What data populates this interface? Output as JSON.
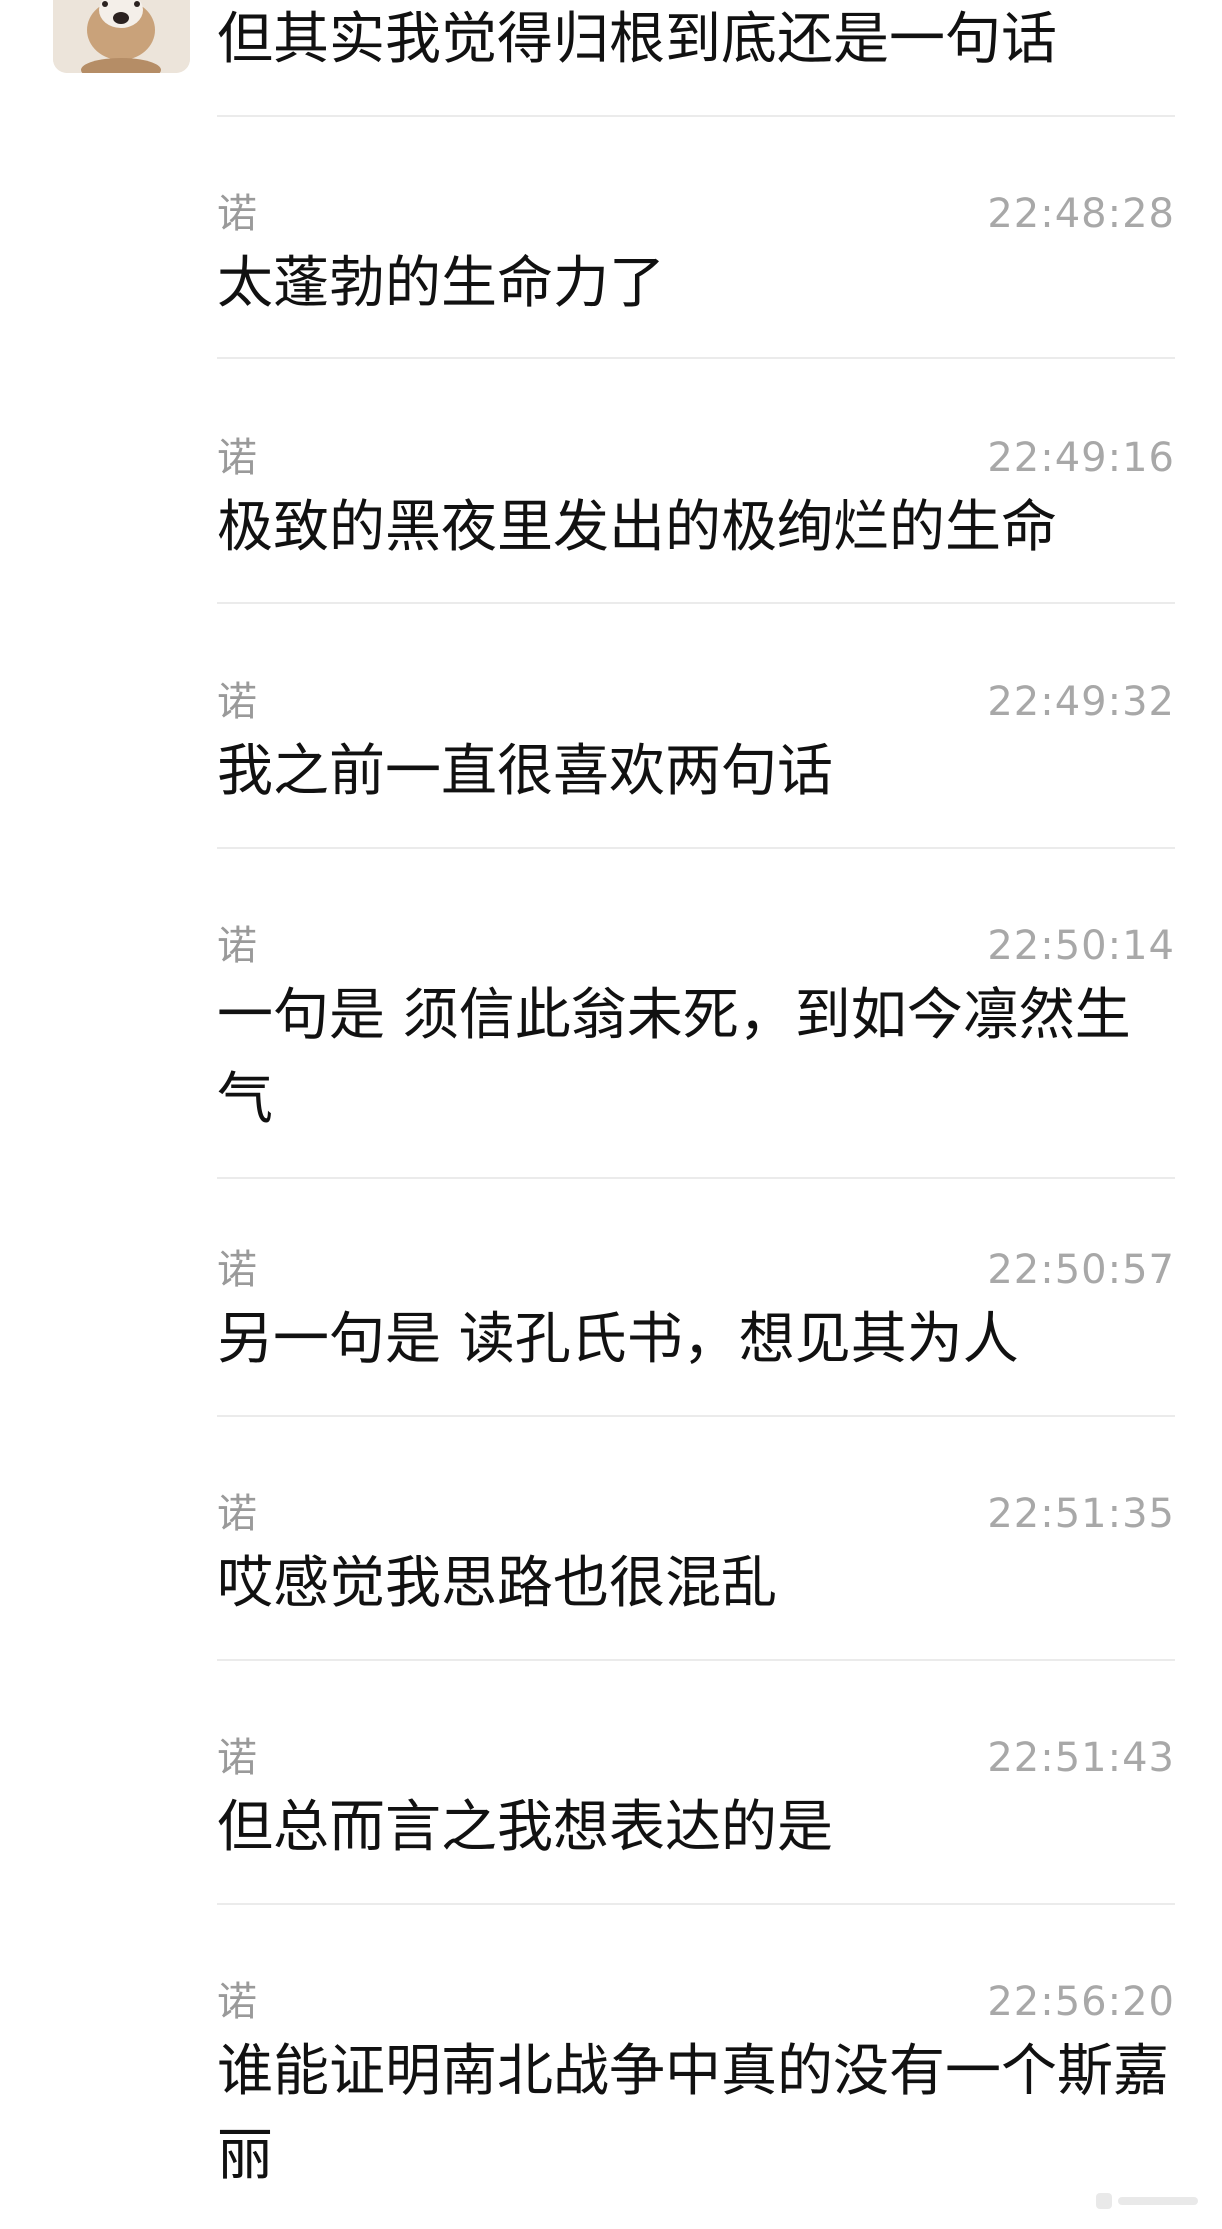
{
  "top_message": {
    "avatar_icon": "plush-dog-avatar-icon",
    "text": "但其实我觉得归根到底还是一句话"
  },
  "messages": [
    {
      "sender": "诺",
      "time": "22:48:28",
      "text": "太蓬勃的生命力了"
    },
    {
      "sender": "诺",
      "time": "22:49:16",
      "text": "极致的黑夜里发出的极绚烂的生命"
    },
    {
      "sender": "诺",
      "time": "22:49:32",
      "text": "我之前一直很喜欢两句话"
    },
    {
      "sender": "诺",
      "time": "22:50:14",
      "text": "一句是 须信此翁未死，到如今凛然生气"
    },
    {
      "sender": "诺",
      "time": "22:50:57",
      "text": "另一句是 读孔氏书，想见其为人"
    },
    {
      "sender": "诺",
      "time": "22:51:35",
      "text": "哎感觉我思路也很混乱"
    },
    {
      "sender": "诺",
      "time": "22:51:43",
      "text": "但总而言之我想表达的是"
    },
    {
      "sender": "诺",
      "time": "22:56:20",
      "text": "谁能证明南北战争中真的没有一个斯嘉丽"
    }
  ]
}
